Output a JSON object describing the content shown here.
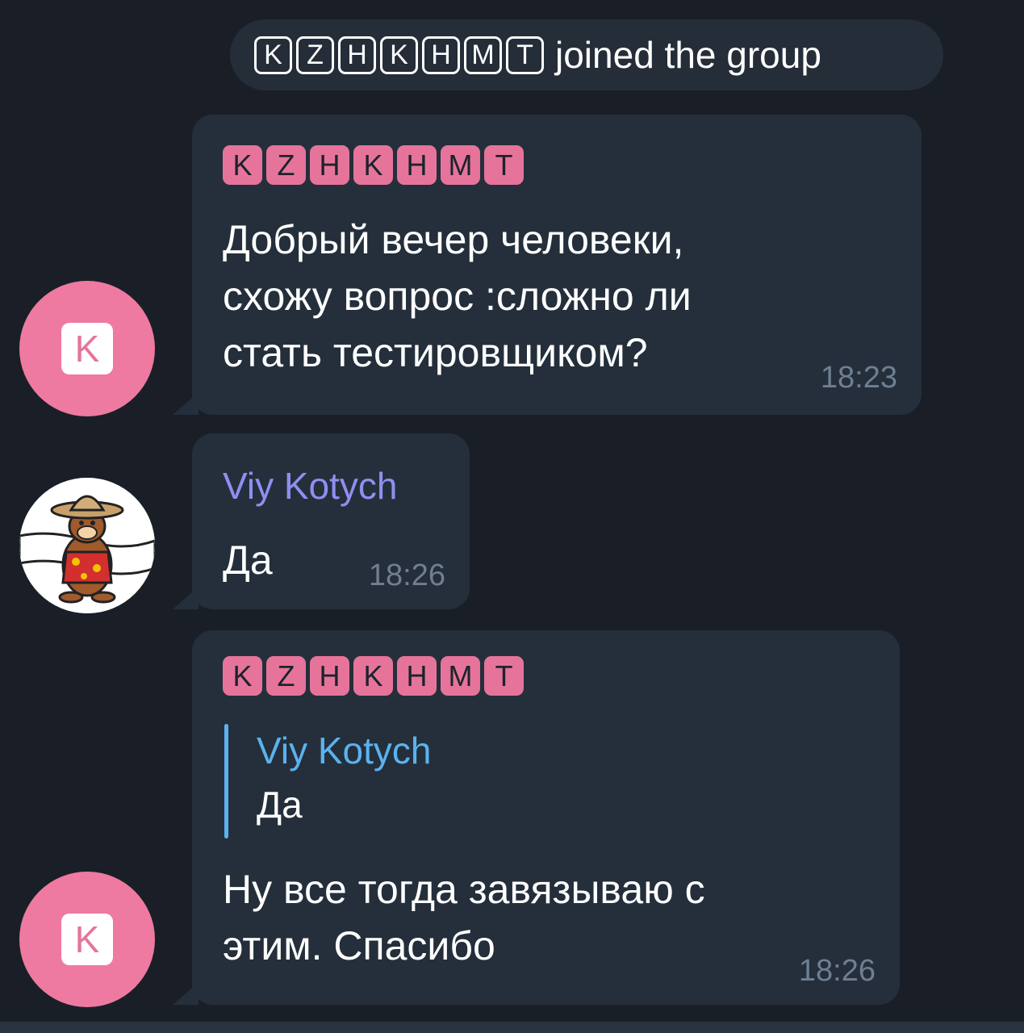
{
  "service_message": {
    "name_glyphs": [
      "K",
      "Z",
      "H",
      "K",
      "H",
      "M",
      "T"
    ],
    "text": "joined the group"
  },
  "messages": [
    {
      "sender_glyphs": [
        "K",
        "Z",
        "H",
        "K",
        "H",
        "M",
        "T"
      ],
      "avatar_letter": "K",
      "text": "Добрый вечер человеки,\nсхожу вопрос :сложно ли\nстать тестировщиком?",
      "time": "18:23"
    },
    {
      "sender": "Viy Kotych",
      "text": "Да",
      "time": "18:26",
      "avatar_description": "chipmunk-avatar"
    },
    {
      "sender_glyphs": [
        "K",
        "Z",
        "H",
        "K",
        "H",
        "M",
        "T"
      ],
      "avatar_letter": "K",
      "reply": {
        "sender": "Viy Kotych",
        "text": "Да"
      },
      "text": "Ну все тогда завязываю с\nэтим. Спасибо",
      "time": "18:26"
    }
  ],
  "colors": {
    "background": "#1a1f27",
    "bubble": "#242f3b",
    "accent_pink": "#e6749a",
    "sender_purple": "#8e8ff0",
    "reply_blue": "#5bb2ee",
    "time_gray": "#6f7f92"
  }
}
